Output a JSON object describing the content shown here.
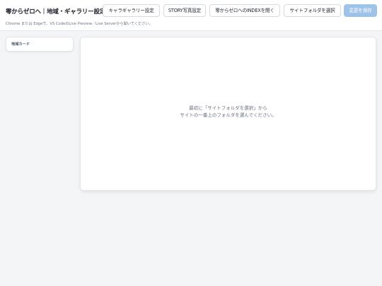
{
  "header": {
    "title": "零からゼロへ｜地域・ギャラリー設定",
    "subtitle": "Chrome または Edgeで、VS CodeのLive Preview／Live Serverから開いてください。",
    "buttons": {
      "chara_gallery": "キャラギャラリー設定",
      "story_photo": "STORY写真設定",
      "open_index": "零からゼロへのINDEXを開く",
      "select_folder": "サイトフォルダを選択",
      "save": "変更を保存"
    }
  },
  "sidebar": {
    "card_title": "地域カード"
  },
  "main": {
    "message_line1": "最初に「サイトフォルダを選択」から",
    "message_line2": "サイトの一番上のフォルダを選んでください。"
  },
  "colors": {
    "save_button_disabled": "#9fc3e8",
    "background": "#f4f5f7"
  }
}
